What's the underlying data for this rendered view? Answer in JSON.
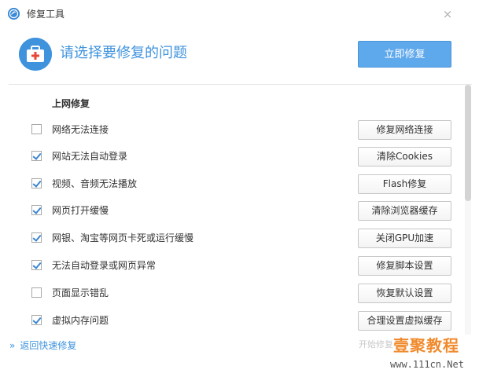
{
  "window": {
    "title": "修复工具",
    "close_glyph": "×"
  },
  "header": {
    "title": "请选择要修复的问题",
    "fix_now_label": "立即修复"
  },
  "section": {
    "title": "上网修复"
  },
  "items": [
    {
      "label": "网络无法连接",
      "checked": false,
      "button": "修复网络连接"
    },
    {
      "label": "网站无法自动登录",
      "checked": true,
      "button": "清除Cookies"
    },
    {
      "label": "视频、音频无法播放",
      "checked": true,
      "button": "Flash修复"
    },
    {
      "label": "网页打开缓慢",
      "checked": true,
      "button": "清除浏览器缓存"
    },
    {
      "label": "网银、淘宝等网页卡死或运行缓慢",
      "checked": true,
      "button": "关闭GPU加速"
    },
    {
      "label": "无法自动登录或网页异常",
      "checked": true,
      "button": "修复脚本设置"
    },
    {
      "label": "页面显示错乱",
      "checked": false,
      "button": "恢复默认设置"
    },
    {
      "label": "虚拟内存问题",
      "checked": true,
      "button": "合理设置虚拟缓存"
    }
  ],
  "footer": {
    "back_chevron": "»",
    "back_label": "返回快速修复"
  },
  "watermark": {
    "hint": "开始修复",
    "brand": "壹聚教程",
    "url": "www.111cn.Net"
  },
  "colors": {
    "accent": "#3f93dd",
    "primary_button": "#5ea8ec",
    "watermark": "#f08a2c"
  }
}
